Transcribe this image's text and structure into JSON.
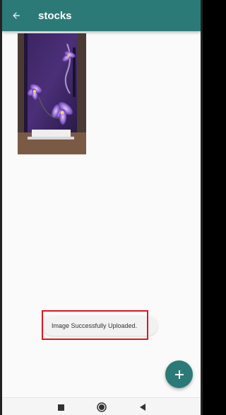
{
  "app_bar": {
    "title": "stocks",
    "back_icon": "arrow-left-icon",
    "color": "#2b7a78"
  },
  "gallery": {
    "items": [
      {
        "type": "image",
        "subject": "purple floral refrigerator photo"
      }
    ]
  },
  "toast": {
    "message": "Image Successfully Uploaded."
  },
  "fab": {
    "icon": "plus-icon",
    "color": "#2b7a78"
  },
  "highlight": {
    "color": "#e0141b"
  },
  "system_nav": {
    "buttons": [
      "recents-square-icon",
      "home-circle-icon",
      "back-triangle-icon"
    ]
  }
}
